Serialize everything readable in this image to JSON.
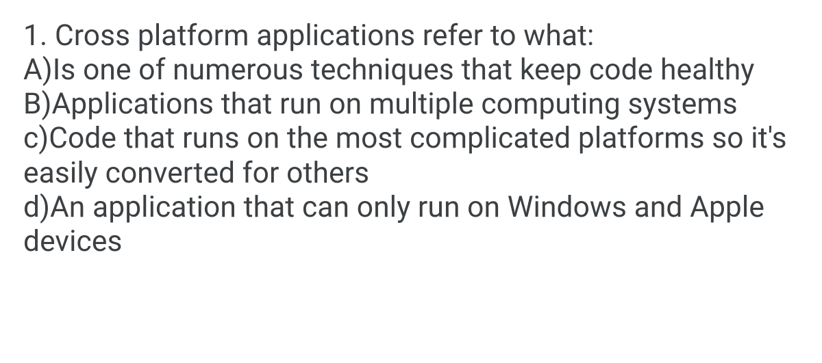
{
  "question": {
    "number": "1.",
    "prompt": "Cross platform applications refer to what:",
    "options": [
      {
        "label": "A)",
        "text": "Is one of numerous techniques that keep code healthy"
      },
      {
        "label": "B)",
        "text": "Applications that run on multiple computing systems"
      },
      {
        "label": "c)",
        "text": "Code that runs on the most complicated platforms so it's easily converted for others"
      },
      {
        "label": "d)",
        "text": "An application that can only run on Windows and Apple devices"
      }
    ]
  }
}
